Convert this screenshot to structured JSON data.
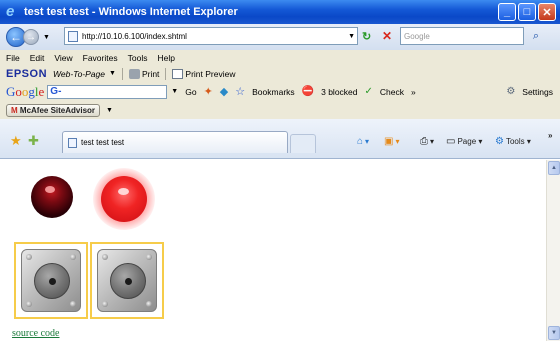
{
  "window": {
    "title": "test test test - Windows Internet Explorer"
  },
  "address": {
    "url": "http://10.10.6.100/index.shtml",
    "search_placeholder": "Google"
  },
  "menu": [
    "File",
    "Edit",
    "View",
    "Favorites",
    "Tools",
    "Help"
  ],
  "epson": {
    "logo": "EPSON",
    "w2p": "Web-To-Page",
    "print": "Print",
    "print_preview": "Print Preview"
  },
  "google": {
    "logo": "Google",
    "search_g": "G-",
    "go": "Go",
    "bookmarks": "Bookmarks",
    "blocked": "3 blocked",
    "check": "Check",
    "more": "»",
    "settings": "Settings"
  },
  "mcafee": {
    "label": "McAfee SiteAdvisor"
  },
  "tab": {
    "label": "test test test"
  },
  "commands": {
    "page": "Page",
    "tools": "Tools",
    "more": "»"
  },
  "content": {
    "source_link": "source code"
  },
  "colors": {
    "led_off": "#2a0006",
    "led_on": "#f02424",
    "button_frame": "#f6cc4a",
    "link": "#1a7a3a"
  }
}
